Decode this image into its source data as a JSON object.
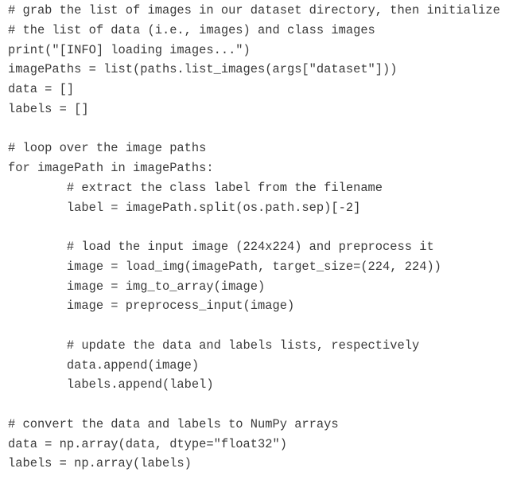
{
  "code": {
    "lines": [
      "# grab the list of images in our dataset directory, then initialize",
      "# the list of data (i.e., images) and class images",
      "print(\"[INFO] loading images...\")",
      "imagePaths = list(paths.list_images(args[\"dataset\"]))",
      "data = []",
      "labels = []",
      "",
      "# loop over the image paths",
      "for imagePath in imagePaths:",
      "        # extract the class label from the filename",
      "        label = imagePath.split(os.path.sep)[-2]",
      "",
      "        # load the input image (224x224) and preprocess it",
      "        image = load_img(imagePath, target_size=(224, 224))",
      "        image = img_to_array(image)",
      "        image = preprocess_input(image)",
      "",
      "        # update the data and labels lists, respectively",
      "        data.append(image)",
      "        labels.append(label)",
      "",
      "# convert the data and labels to NumPy arrays",
      "data = np.array(data, dtype=\"float32\")",
      "labels = np.array(labels)"
    ]
  }
}
